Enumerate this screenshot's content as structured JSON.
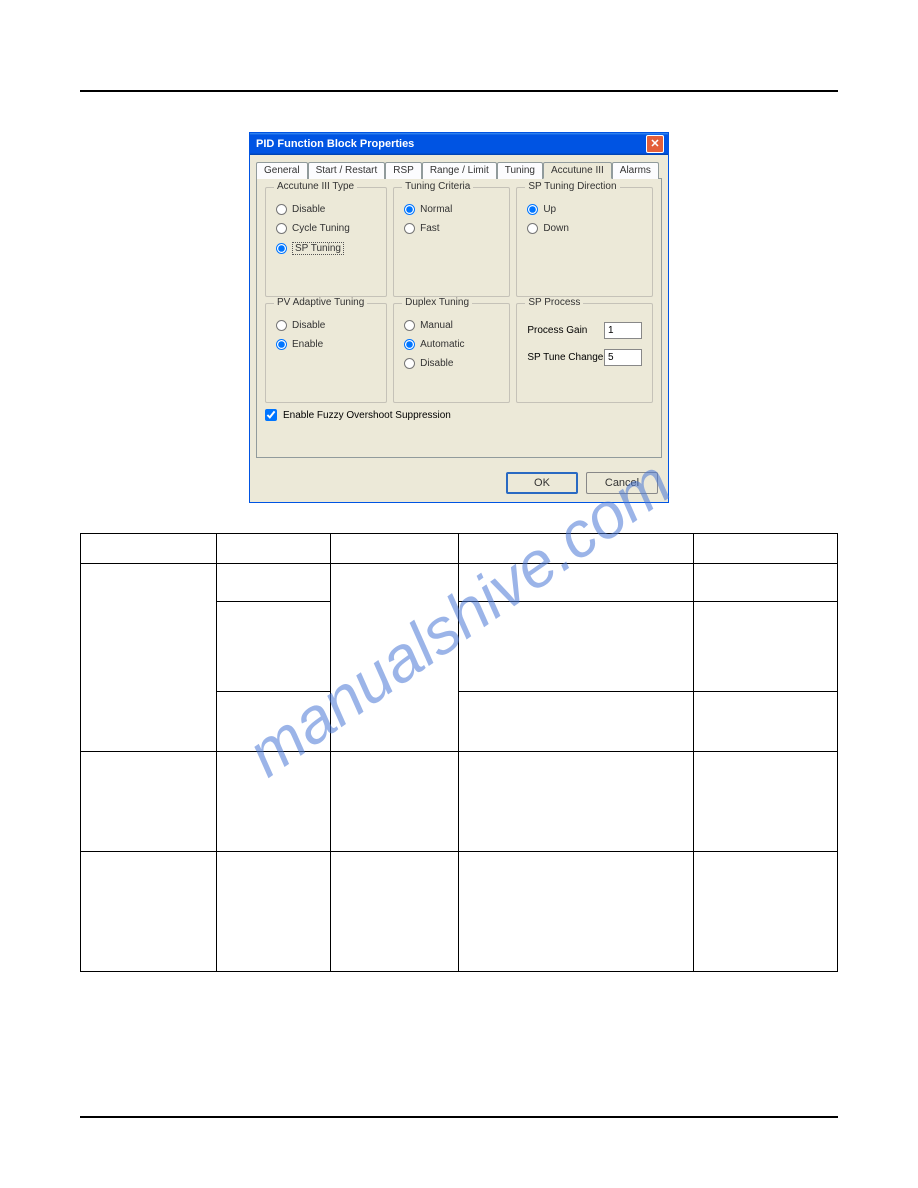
{
  "dialog": {
    "title": "PID Function Block Properties",
    "tabs": [
      "General",
      "Start / Restart",
      "RSP",
      "Range / Limit",
      "Tuning",
      "Accutune III",
      "Alarms"
    ],
    "active_tab": "Accutune III",
    "groups": {
      "accutune_type": {
        "legend": "Accutune III Type",
        "options": [
          "Disable",
          "Cycle Tuning",
          "SP Tuning"
        ],
        "selected": "SP Tuning"
      },
      "tuning_criteria": {
        "legend": "Tuning Criteria",
        "options": [
          "Normal",
          "Fast"
        ],
        "selected": "Normal"
      },
      "sp_tuning_direction": {
        "legend": "SP Tuning Direction",
        "options": [
          "Up",
          "Down"
        ],
        "selected": "Up"
      },
      "pv_adaptive": {
        "legend": "PV Adaptive Tuning",
        "options": [
          "Disable",
          "Enable"
        ],
        "selected": "Enable"
      },
      "duplex_tuning": {
        "legend": "Duplex Tuning",
        "options": [
          "Manual",
          "Automatic",
          "Disable"
        ],
        "selected": "Automatic"
      },
      "sp_process": {
        "legend": "SP Process",
        "process_gain_label": "Process Gain",
        "process_gain_value": "1",
        "sp_tune_change_label": "SP Tune Change",
        "sp_tune_change_value": "5"
      }
    },
    "fuzzy_checkbox": {
      "label": "Enable Fuzzy Overshoot Suppression",
      "checked": true
    },
    "buttons": {
      "ok": "OK",
      "cancel": "Cancel"
    }
  },
  "watermark": "manualshive.com"
}
